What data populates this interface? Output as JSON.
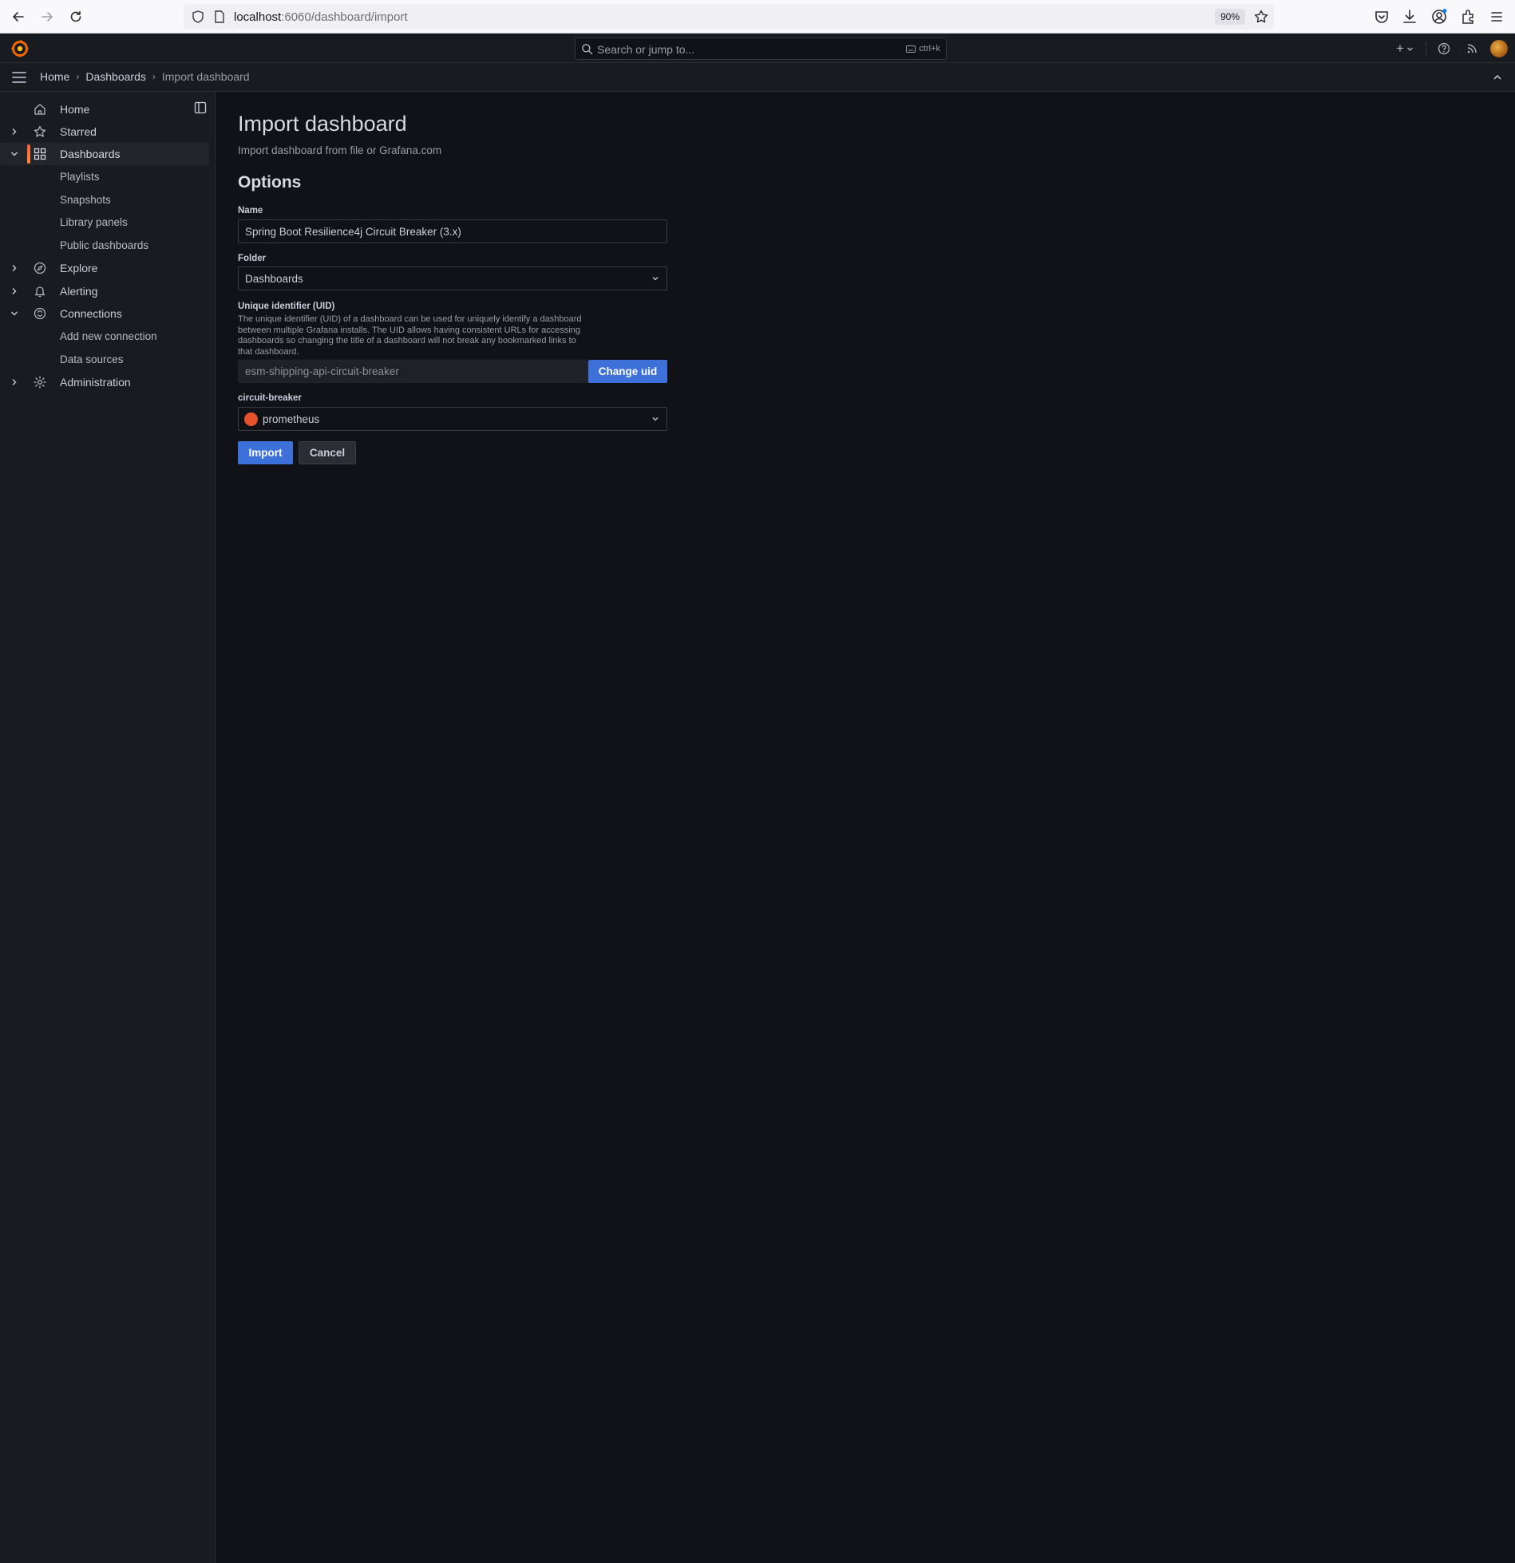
{
  "browser": {
    "url_host": "localhost",
    "url_rest": ":6060/dashboard/import",
    "zoom": "90%"
  },
  "topbar": {
    "search_placeholder": "Search or jump to...",
    "search_shortcut": "ctrl+k",
    "add_icon": "+"
  },
  "breadcrumb": {
    "items": [
      "Home",
      "Dashboards",
      "Import dashboard"
    ]
  },
  "sidebar": {
    "items": [
      {
        "label": "Home",
        "icon": "home-icon"
      },
      {
        "label": "Starred",
        "icon": "star-icon"
      },
      {
        "label": "Dashboards",
        "icon": "apps-icon"
      },
      {
        "label": "Explore",
        "icon": "compass-icon"
      },
      {
        "label": "Alerting",
        "icon": "bell-icon"
      },
      {
        "label": "Connections",
        "icon": "link-icon"
      },
      {
        "label": "Administration",
        "icon": "cog-icon"
      }
    ],
    "dashboards_children": [
      "Playlists",
      "Snapshots",
      "Library panels",
      "Public dashboards"
    ],
    "connections_children": [
      "Add new connection",
      "Data sources"
    ]
  },
  "page": {
    "title": "Import dashboard",
    "subtitle": "Import dashboard from file or Grafana.com",
    "options_title": "Options"
  },
  "form": {
    "name_label": "Name",
    "name_value": "Spring Boot Resilience4j Circuit Breaker (3.x)",
    "folder_label": "Folder",
    "folder_value": "Dashboards",
    "uid_label": "Unique identifier (UID)",
    "uid_description": "The unique identifier (UID) of a dashboard can be used for uniquely identify a dashboard between multiple Grafana installs. The UID allows having consistent URLs for accessing dashboards so changing the title of a dashboard will not break any bookmarked links to that dashboard.",
    "uid_value": "esm-shipping-api-circuit-breaker",
    "change_uid_label": "Change uid",
    "datasource_label": "circuit-breaker",
    "datasource_value": "prometheus",
    "import_label": "Import",
    "cancel_label": "Cancel"
  },
  "colors": {
    "background": "#111217",
    "panel": "#181b1f",
    "primary": "#3d71d9",
    "accent": "#f55f3e"
  }
}
